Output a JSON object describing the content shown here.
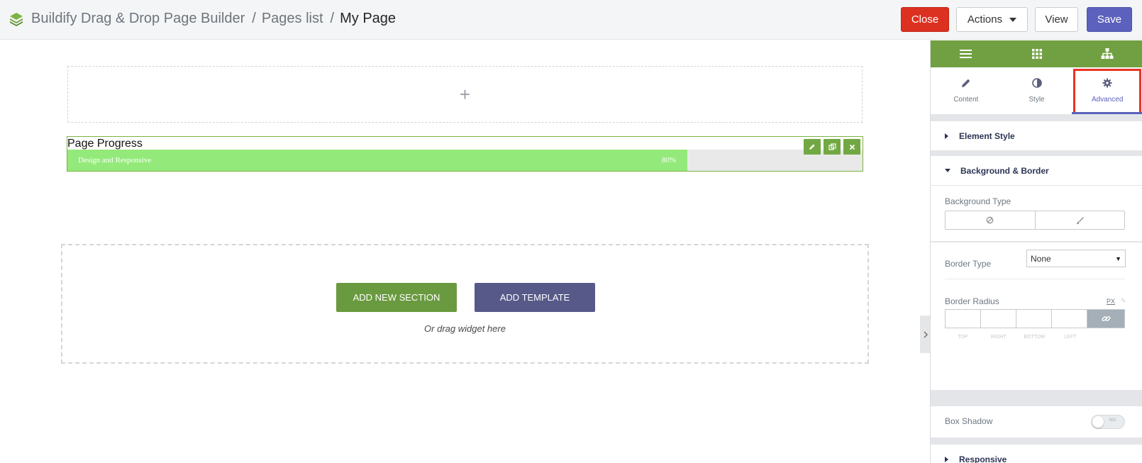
{
  "header": {
    "app_name": "Buildify Drag & Drop Page Builder",
    "breadcrumb_sep": "/",
    "pages_list": "Pages list",
    "current_page": "My Page",
    "close_label": "Close",
    "actions_label": "Actions",
    "view_label": "View",
    "save_label": "Save",
    "close_color": "#dc3120",
    "save_color": "#5c61bd"
  },
  "canvas": {
    "add_column_symbol": "+",
    "widget": {
      "title": "Page Progress",
      "bar_label": "Design and Responsive",
      "percent_text": "80%",
      "percent": 80,
      "fill_color": "#93ea7a"
    },
    "add_section_label": "ADD NEW SECTION",
    "add_template_label": "ADD TEMPLATE",
    "drag_hint": "Or drag widget here"
  },
  "panel": {
    "accent_color": "#71a042",
    "tabs": [
      {
        "label": "Content",
        "icon": "pencil-icon"
      },
      {
        "label": "Style",
        "icon": "contrast-icon"
      },
      {
        "label": "Advanced",
        "icon": "gear-icon"
      }
    ],
    "active_tab": "Advanced",
    "sections": {
      "element_style": "Element Style",
      "background_border": "Background & Border",
      "responsive": "Responsive"
    },
    "background_type_label": "Background Type",
    "border_type_label": "Border Type",
    "border_type_value": "None",
    "border_radius_label": "Border Radius",
    "border_radius_unit": "PX",
    "dimension_labels": [
      "TOP",
      "RIGHT",
      "BOTTOM",
      "LEFT"
    ],
    "box_shadow_label": "Box Shadow",
    "box_shadow_toggle_text": "NO"
  }
}
